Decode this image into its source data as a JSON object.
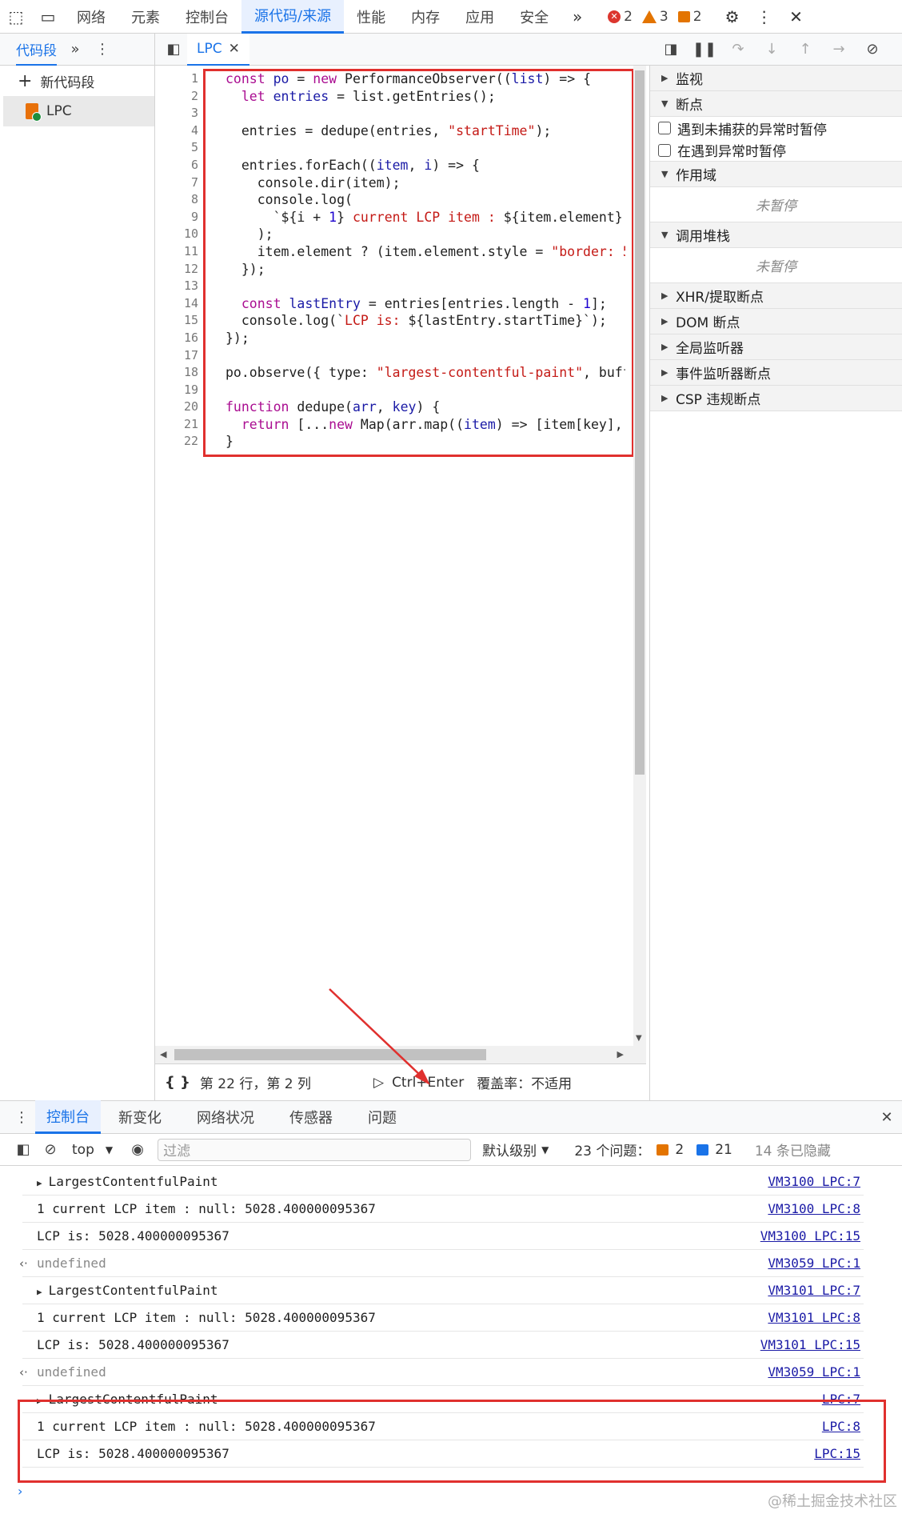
{
  "top_tabs": [
    "网络",
    "元素",
    "控制台",
    "源代码/来源",
    "性能",
    "内存",
    "应用",
    "安全"
  ],
  "badges": {
    "errors": "2",
    "warnings": "3",
    "issues": "2"
  },
  "snippets": {
    "header": "代码段",
    "new": "新代码段",
    "file": "LPC"
  },
  "editor": {
    "tab": "LPC",
    "line_numbers": [
      "1",
      "2",
      "3",
      "4",
      "5",
      "6",
      "7",
      "8",
      "9",
      "10",
      "11",
      "12",
      "13",
      "14",
      "15",
      "16",
      "17",
      "18",
      "19",
      "20",
      "21",
      "22"
    ],
    "status_position": "第 22 行，第 2 列",
    "run_shortcut": "Ctrl+Enter",
    "coverage": "覆盖率：不适用"
  },
  "debugger": {
    "watch": "监视",
    "breakpoints": "断点",
    "pause_uncaught": "遇到未捕获的异常时暂停",
    "pause_caught": "在遇到异常时暂停",
    "scope": "作用域",
    "not_paused_1": "未暂停",
    "call_stack": "调用堆栈",
    "not_paused_2": "未暂停",
    "xhr": "XHR/提取断点",
    "dom": "DOM 断点",
    "global": "全局监听器",
    "event": "事件监听器断点",
    "csp": "CSP 违规断点"
  },
  "drawer_tabs": [
    "控制台",
    "新变化",
    "网络状况",
    "传感器",
    "问题"
  ],
  "console_toolbar": {
    "context": "top",
    "filter_placeholder": "过滤",
    "level": "默认级别",
    "issues_label": "23 个问题：",
    "issues_warn": "2",
    "issues_info": "21",
    "hidden": "14 条已隐藏"
  },
  "console_rows": [
    {
      "text": "LargestContentfulPaint",
      "src": "VM3100 LPC:7"
    },
    {
      "text": "1 current LCP item : null: 5028.400000095367",
      "src": "VM3100 LPC:8"
    },
    {
      "text": "LCP is: 5028.400000095367",
      "src": "VM3100 LPC:15"
    },
    {
      "text": "undefined",
      "src": "VM3059 LPC:1"
    },
    {
      "text": "LargestContentfulPaint",
      "src": "VM3101 LPC:7"
    },
    {
      "text": "1 current LCP item : null: 5028.400000095367",
      "src": "VM3101 LPC:8"
    },
    {
      "text": "LCP is: 5028.400000095367",
      "src": "VM3101 LPC:15"
    },
    {
      "text": "undefined",
      "src": "VM3059 LPC:1"
    },
    {
      "text": "LargestContentfulPaint",
      "src": "LPC:7"
    },
    {
      "text": "1 current LCP item : null: 5028.400000095367",
      "src": "LPC:8"
    },
    {
      "text": "LCP is: 5028.400000095367",
      "src": "LPC:15"
    }
  ],
  "watermark": "@稀土掘金技术社区",
  "colors": {
    "accent": "#1a73e8",
    "highlight_box": "#e0302e"
  }
}
